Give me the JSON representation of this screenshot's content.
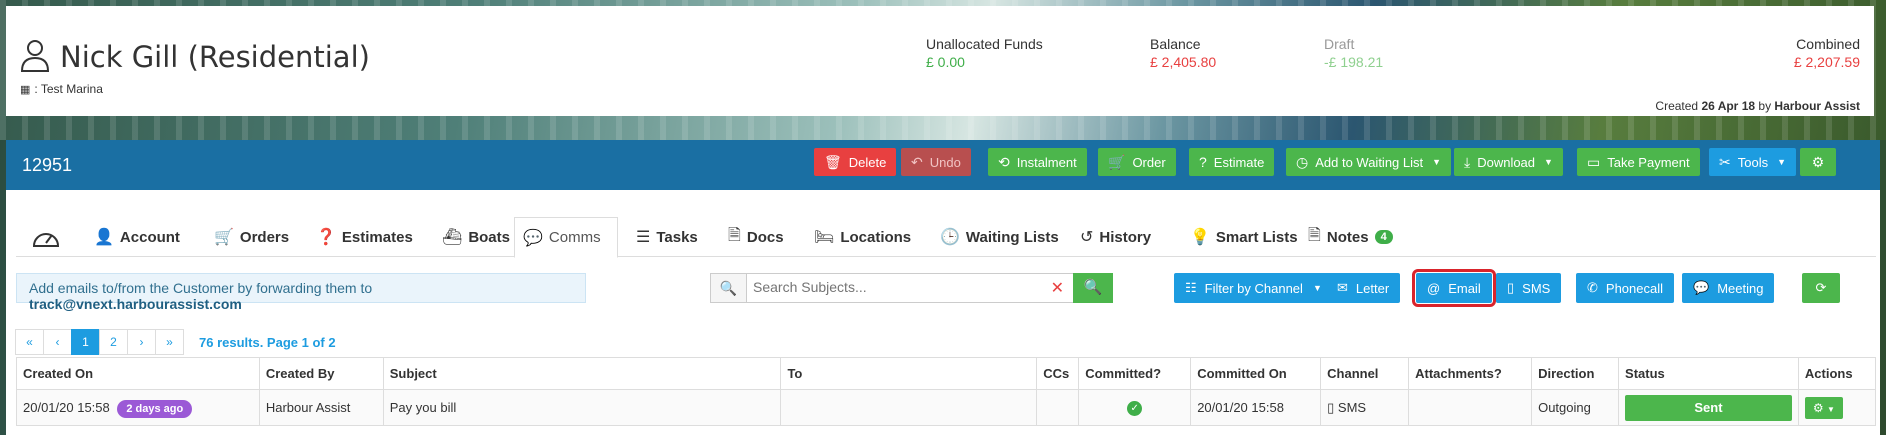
{
  "header": {
    "name": "Nick Gill (Residential)",
    "marina": ": Test Marina",
    "funds": [
      {
        "label": "Unallocated Funds",
        "value": "£ 0.00"
      },
      {
        "label": "Balance",
        "value": "£ 2,405.80"
      },
      {
        "label": "Draft",
        "value": "-£ 198.21"
      },
      {
        "label": "Combined",
        "value": "£ 2,207.59"
      }
    ],
    "created_prefix": "Created",
    "created_date": "26 Apr 18",
    "created_by_word": "by",
    "created_by": "Harbour Assist"
  },
  "record_id": "12951",
  "actions": [
    {
      "label": "Delete",
      "icon": "trash-icon"
    },
    {
      "label": "Undo",
      "icon": "undo-icon"
    },
    {
      "label": "Instalment",
      "icon": "refresh-icon"
    },
    {
      "label": "Order",
      "icon": "cart-icon"
    },
    {
      "label": "Estimate",
      "icon": "question-icon"
    },
    {
      "label": "Add to Waiting List",
      "icon": "clock-icon"
    },
    {
      "label": "Download",
      "icon": "download-icon"
    },
    {
      "label": "Take Payment",
      "icon": "money-icon"
    },
    {
      "label": "Tools",
      "icon": "tools-icon"
    }
  ],
  "tabs": [
    {
      "label": "Account"
    },
    {
      "label": "Orders"
    },
    {
      "label": "Estimates"
    },
    {
      "label": "Boats"
    },
    {
      "label": "Comms"
    },
    {
      "label": "Tasks"
    },
    {
      "label": "Docs"
    },
    {
      "label": "Locations"
    },
    {
      "label": "Waiting Lists"
    },
    {
      "label": "History"
    },
    {
      "label": "Smart Lists"
    },
    {
      "label": "Notes",
      "badge": "4"
    }
  ],
  "info": {
    "text": "Add emails to/from the Customer by forwarding them to",
    "email": "track@vnext.harbourassist.com"
  },
  "search": {
    "placeholder": "Search Subjects..."
  },
  "toolbar": {
    "filter": "Filter by Channel",
    "letter": "Letter",
    "email": "Email",
    "sms": "SMS",
    "phonecall": "Phonecall",
    "meeting": "Meeting"
  },
  "pager": {
    "first": "«",
    "prev": "‹",
    "p1": "1",
    "p2": "2",
    "next": "›",
    "last": "»",
    "results": "76 results. Page 1 of 2"
  },
  "table": {
    "columns": [
      "Created On",
      "Created By",
      "Subject",
      "To",
      "CCs",
      "Committed?",
      "Committed On",
      "Channel",
      "Attachments?",
      "Direction",
      "Status",
      "Actions"
    ],
    "rows": [
      {
        "created_on": "20/01/20 15:58",
        "age": "2 days ago",
        "created_by": "Harbour Assist",
        "subject": "Pay you bill",
        "to": "",
        "ccs": "",
        "committed_on": "20/01/20 15:58",
        "channel": "SMS",
        "attachments": "",
        "direction": "Outgoing",
        "status": "Sent"
      }
    ]
  }
}
